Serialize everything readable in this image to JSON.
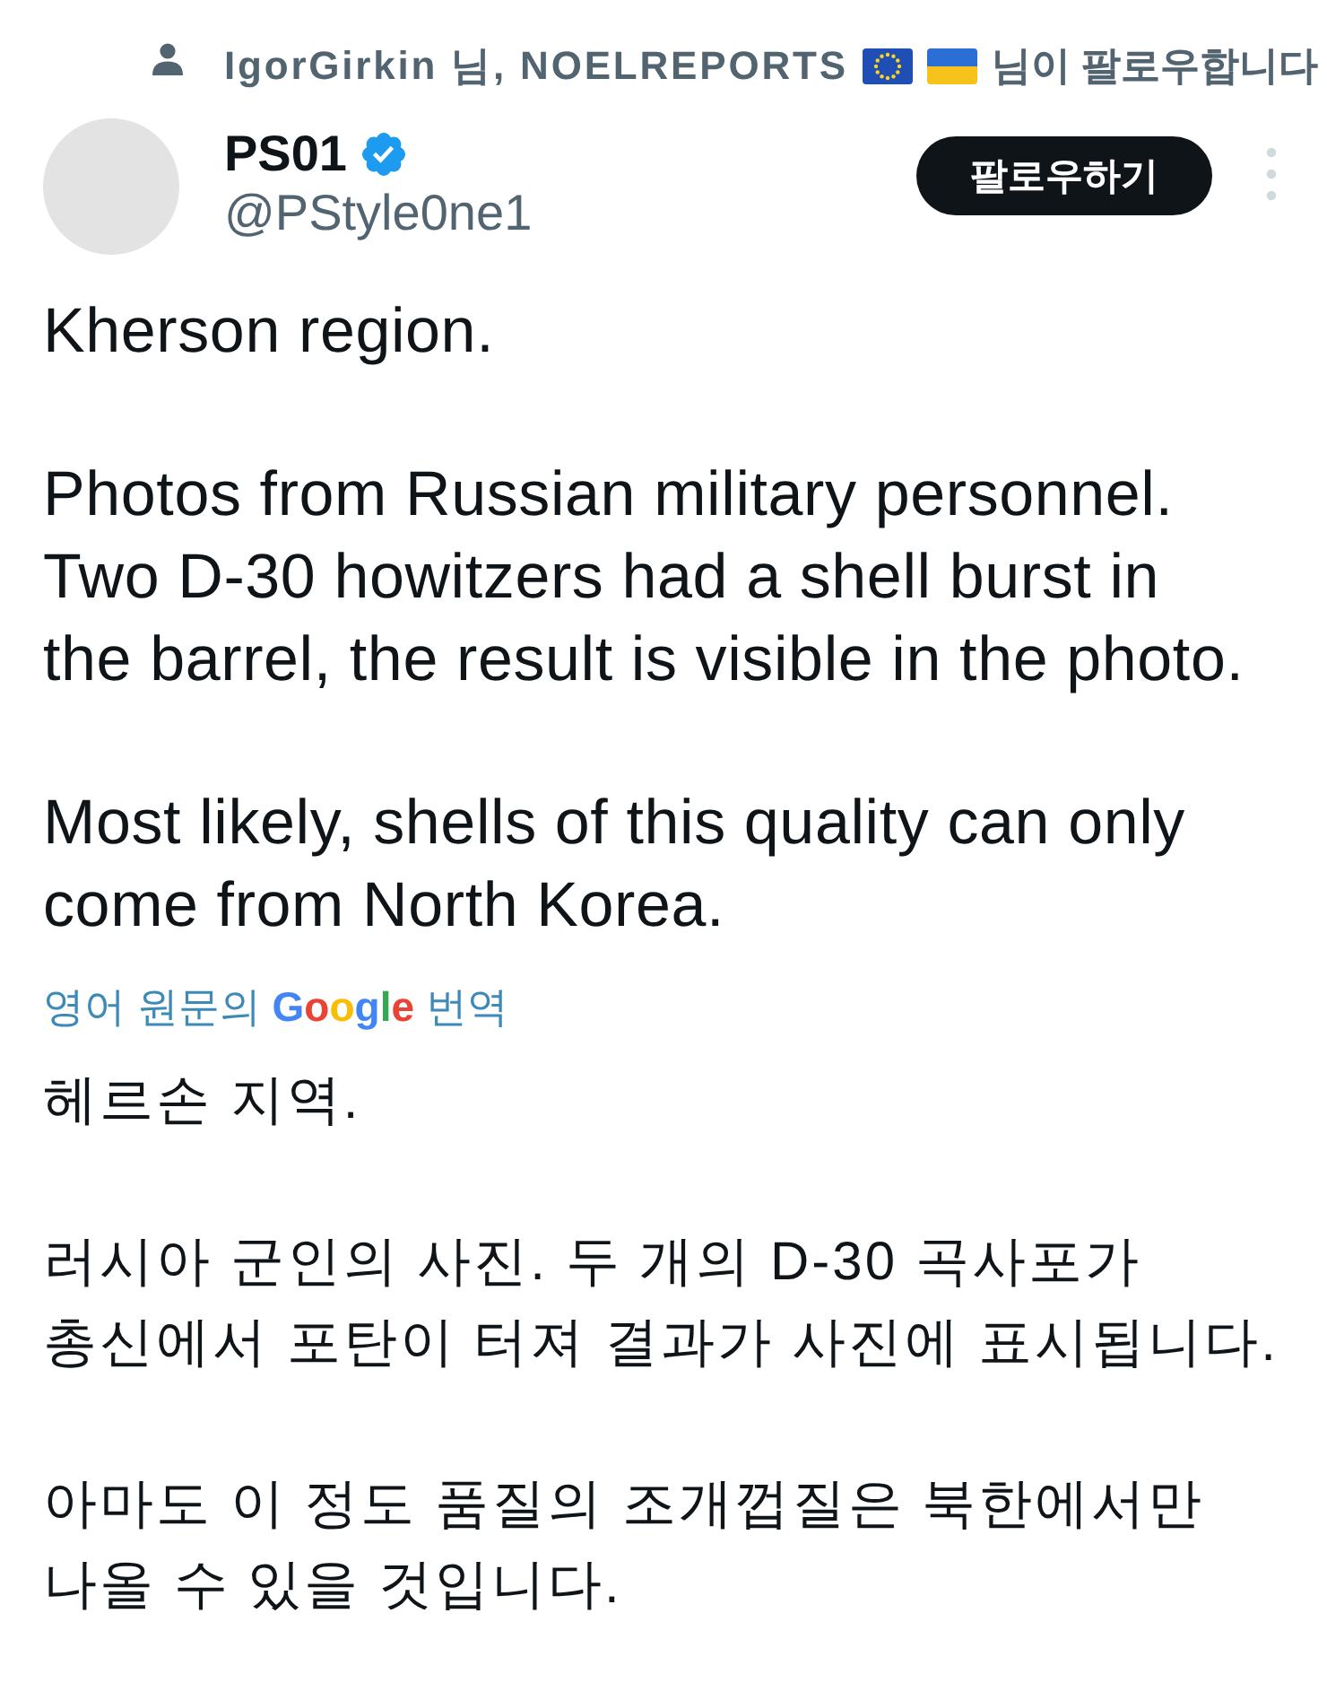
{
  "social_context": {
    "before": "IgorGirkin 님, NOELREPORTS",
    "flags": [
      {
        "kind": "eu"
      },
      {
        "kind": "ukraine"
      }
    ],
    "after": "님이 팔로우합니다"
  },
  "author": {
    "name": "PS01",
    "verified": true,
    "handle": "@PStyle0ne1"
  },
  "follow_button": "팔로우하기",
  "original_text": [
    "Kherson region.",
    "Photos from Russian military personnel.\nTwo D-30 howitzers had a shell burst in\nthe barrel, the result is visible in the photo.",
    "Most likely, shells of this quality can only\ncome from North Korea."
  ],
  "translation_link": {
    "before": "영어 원문의",
    "brand": "Google",
    "after": "번역"
  },
  "translated_text": [
    "헤르손 지역.",
    "러시아 군인의 사진. 두 개의 D-30 곡사포가\n총신에서 포탄이 터져 결과가 사진에 표시됩니다.",
    "아마도 이 정도 품질의 조개껍질은 북한에서만\n나올 수 있을 것입니다."
  ]
}
